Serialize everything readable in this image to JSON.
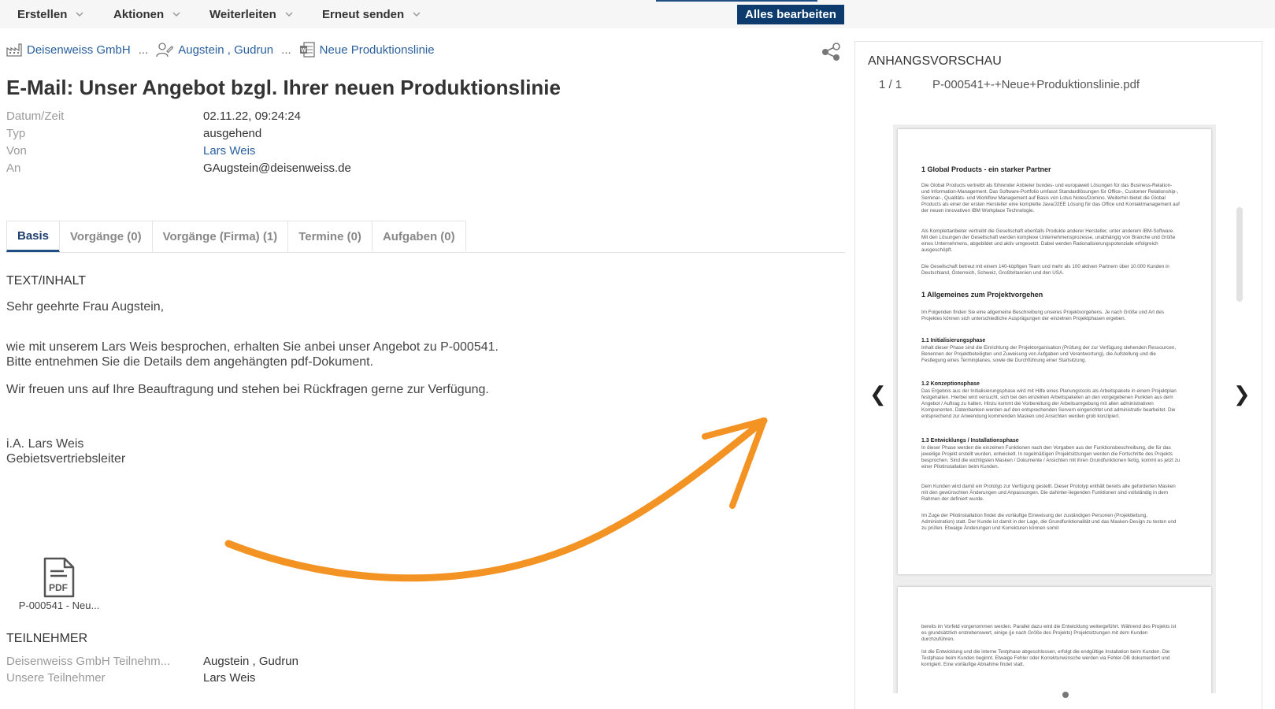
{
  "toolbar": {
    "erstellen": "Erstellen",
    "aktionen": "Aktionen",
    "weiterleiten": "Weiterleiten",
    "erneut_senden": "Erneut senden",
    "alles_bearbeiten": "Alles bearbeiten"
  },
  "breadcrumb": {
    "company": "Deisenweiss GmbH",
    "sep": "...",
    "contact": "Augstein , Gudrun",
    "project": "Neue Produktionslinie"
  },
  "title": "E-Mail: Unser Angebot bzgl. Ihrer neuen Produktionslinie",
  "meta": [
    {
      "label": "Datum/Zeit",
      "value": "02.11.22, 09:24:24"
    },
    {
      "label": "Typ",
      "value": "ausgehend"
    },
    {
      "label": "Von",
      "value": "Lars Weis"
    },
    {
      "label": "An",
      "value": "GAugstein@deisenweiss.de"
    }
  ],
  "tabs": [
    {
      "label": "Basis"
    },
    {
      "label": "Vorgänge (0)"
    },
    {
      "label": "Vorgänge (Firma) (1)"
    },
    {
      "label": "Termine (0)"
    },
    {
      "label": "Aufgaben (0)"
    }
  ],
  "content": {
    "heading": "TEXT/INHALT",
    "greeting": "Sehr geehrte Frau Augstein,",
    "line1": "wie mit unserem Lars Weis besprochen, erhalten Sie anbei unser Angebot zu P-000541.",
    "line2": "Bitte entnehmen Sie die Details dem angehängten pdf-Dokument.",
    "line3": "Wir freuen uns auf Ihre Beauftragung und stehen bei Rückfragen gerne zur Verfügung.",
    "sign1": "i.A. Lars Weis",
    "sign2": "Gebietsvertriebsleiter",
    "attachment_label": "P-000541 - Neu..."
  },
  "participants": {
    "heading": "TEILNEHMER",
    "rows": [
      {
        "label": "Deisenweiss GmbH Teilnehm...",
        "value": "Augstein , Gudrun"
      },
      {
        "label": "Unsere Teilnehmer",
        "value": "Lars Weis"
      }
    ]
  },
  "preview": {
    "title": "ANHANGSVORSCHAU",
    "count": "1 / 1",
    "filename": "P-000541+-+Neue+Produktionslinie.pdf",
    "prev": "❮",
    "next": "❯",
    "doc": {
      "h1": "1    Global Products - ein starker Partner",
      "p1": "Die Global Products vertreibt als führender Anbieter bundes- und europaweit Lösungen für das Business-Relation- und Information-Management. Das Software-Portfolio umfasst Standardlösungen für Office-, Customer Relationship-, Seminar-, Qualitäts- und Workflow Management auf Basis von Lotus Notes/Domino. Weiterhin bietet die Global Products als einer der ersten Hersteller eine komplette Java/J2EE Lösung für das Office und Kontaktmanagement auf der neuen innovativen IBM Workplace Technologie.",
      "p2": "Als Komplettanbieter vertreibt die Gesellschaft ebenfalls Produkte anderer Hersteller, unter anderem IBM-Software. Mit den Lösungen der Gesellschaft werden komplexe Unternehmensprozesse, unabhängig von Branche und Größe eines Unternehmens, abgebildet und aktiv umgesetzt. Dabei werden Rationalisierungspotenziale erfolgreich ausgeschöpft.",
      "p3": "Die Gesellschaft betreut mit einem 140-köpfigen Team und mehr als 100 aktiven Partnern über 10.000 Kunden in Deutschland, Österreich, Schweiz, Großbritannien und den USA.",
      "h2": "1    Allgemeines zum Projektvorgehen",
      "p4": "Im Folgenden finden Sie eine allgemeine Beschreibung unseres Projektvorgehens. Je nach Größe und Art des Projektes können sich unterschiedliche Ausprägungen der einzelnen Projektphasen ergeben.",
      "s1": "1.1    Initialisierungsphase",
      "p5": "Inhalt dieser Phase sind die Einrichtung der Projektorganisation (Prüfung der zur Verfügung stehenden Ressourcen, Benennen der Projektbeteiligten und Zuweisung von Aufgaben und Verantwortung), die Aufstellung und die Festlegung eines Terminplanes, sowie die Durchführung einer Startsitzung.",
      "s2": "1.2    Konzeptionsphase",
      "p6": "Das Ergebnis aus der Initialisierungsphase wird mit Hilfe eines Planungstools als Arbeitspakete in einem Projektplan festgehalten. Hierbei wird versucht, sich bei den einzelnen Arbeitspaketen an den vorgegebenen Punkten aus dem Angebot / Auftrag zu halten. Hinzu kommt die Vorbereitung der Arbeitsumgebung mit allen administrativen Komponenten. Datenbanken werden auf den entsprechenden Servern eingerichtet und administrativ bearbeitet. Die entsprechend zur Anwendung kommenden Masken und Ansichten werden grob konzipiert.",
      "s3": "1.3    Entwicklungs / Installationsphase",
      "p7": "In dieser Phase werden die einzelnen Funktionen nach den Vorgaben aus der Funktionsbeschreibung, die für das jeweilige Projekt erstellt wurden, entwickelt. In regelmäßigen Projektsitzungen werden die Fortschritte des Projekts besprochen. Sind die wichtigsten Masken / Dokumente / Ansichten mit ihren Grundfunktionen fertig, kommt es jetzt zu einer Pilotinstallation beim Kunden.",
      "p8": "Dem Kunden wird damit ein Prototyp zur Verfügung gestellt. Dieser Prototyp enthält bereits alle geforderten Masken mit den gewünschten Änderungen und Anpassungen. Die dahinter-liegenden Funktionen sind vollständig in dem Rahmen der definiert wurde.",
      "p9": "Im Zuge der Pilotinstallation findet die vorläufige Einweisung der zuständigen Personen (Projektleitung, Administration) statt. Der Kunde ist damit in der Lage, die Grundfunktionalität und das Masken-Design zu testen und zu prüfen. Etwaige Änderungen und Korrekturen können somit",
      "p10": "bereits im Vorfeld vorgenommen werden. Parallel dazu wird die Entwicklung weitergeführt. Während des Projekts ist es grundsätzlich erstrebenswert, einige (je nach Größe des Projekts) Projektsitzungen mit dem Kunden durchzuführen.",
      "p11": "Ist die Entwicklung und die interne Testphase abgeschlossen, erfolgt die endgültige Installation beim Kunden. Die Testphase beim Kunden beginnt. Etwaige Fehler oder Korrekturwünsche werden via Fehler-DB dokumentiert und korrigiert. Eine vorläufige Abnahme findet statt."
    }
  },
  "colors": {
    "link": "#2a5f9e",
    "primary_button": "#0d3b6e",
    "arrow": "#f39324"
  }
}
